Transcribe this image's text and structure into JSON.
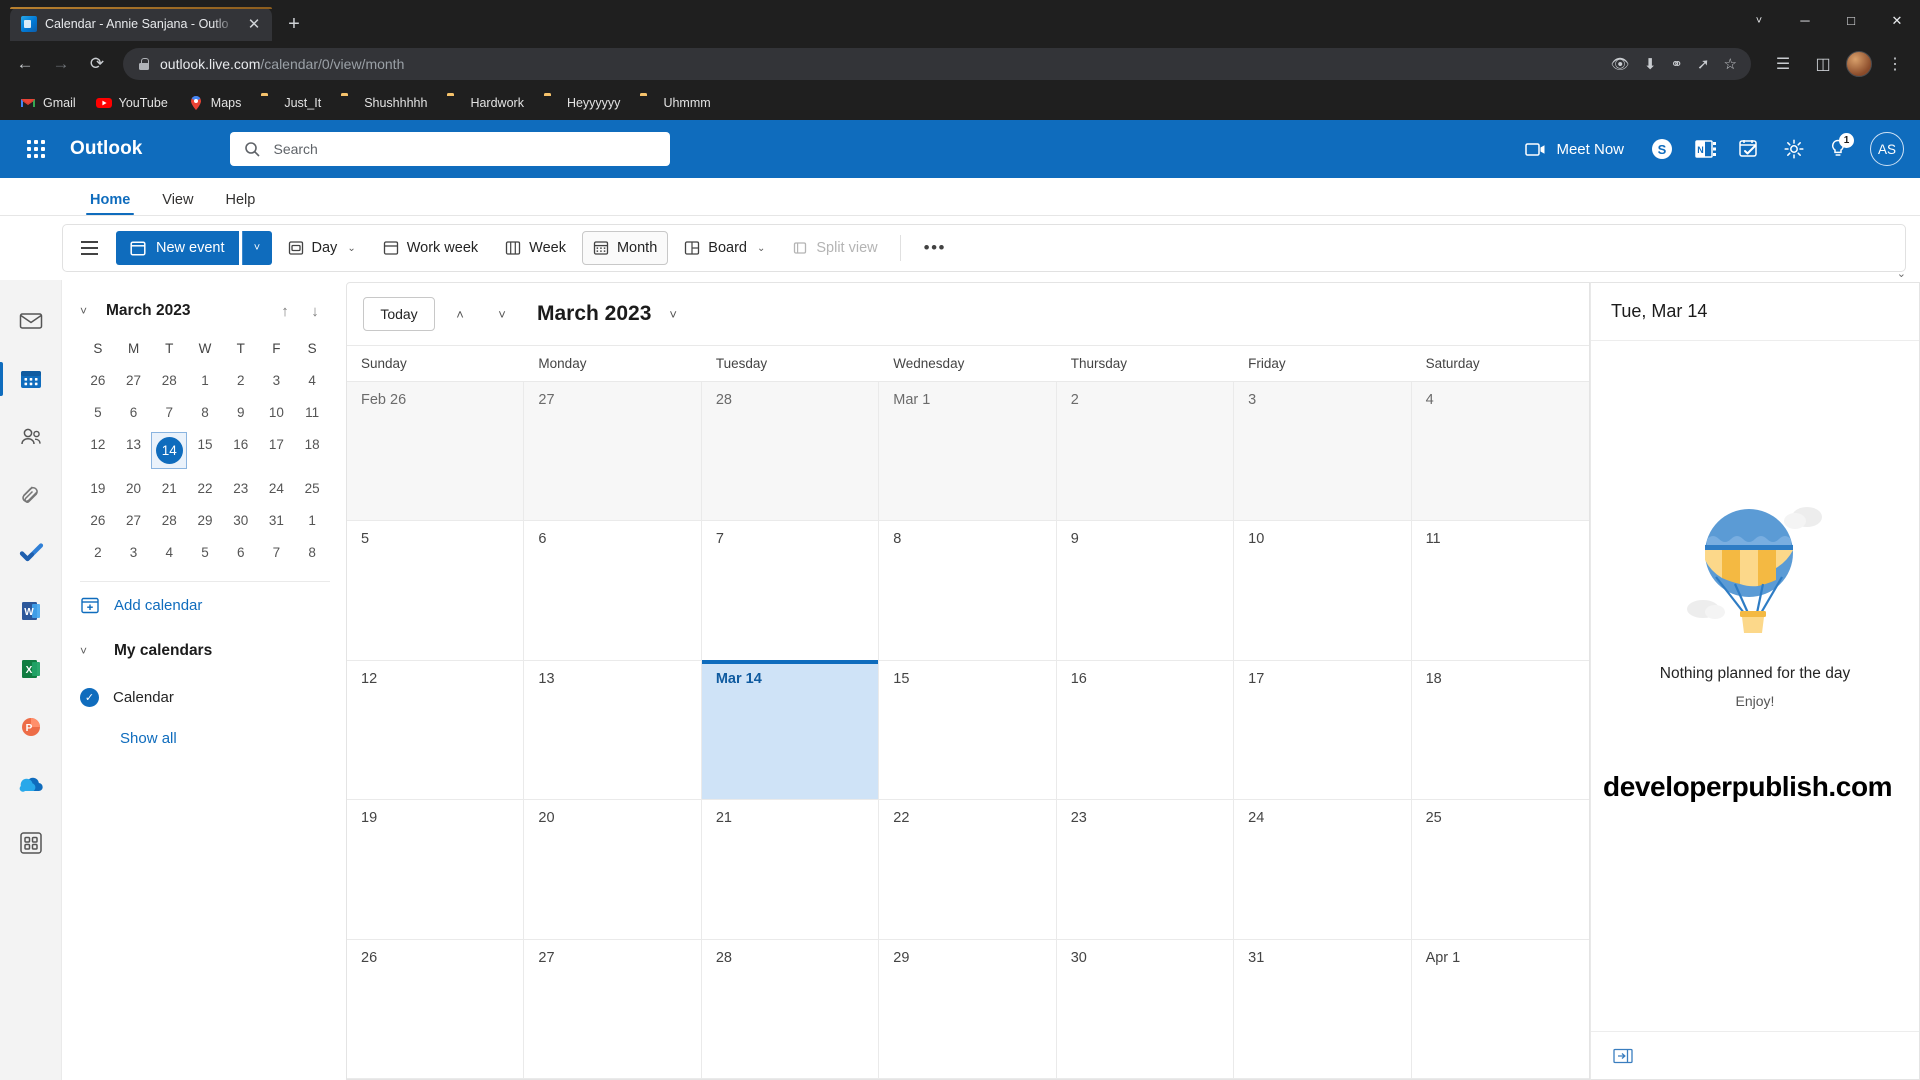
{
  "browser": {
    "tab": {
      "title": "Calendar - Annie Sanjana - Outlo",
      "favicon": "outlook-favicon",
      "close_label": "✕"
    },
    "new_tab_label": "+",
    "window_controls": {
      "more": "˅",
      "minimize": "─",
      "maximize": "□",
      "close": "✕"
    },
    "nav": {
      "back": "←",
      "forward": "→",
      "reload": "⟳"
    },
    "omnibox": {
      "url_domain": "outlook.live.com",
      "url_path": "/calendar/0/view/month"
    },
    "omnibox_icons": [
      "eye-icon",
      "download-icon",
      "eye-off-icon",
      "share-icon",
      "star-icon"
    ],
    "nav_right_icons": [
      "reading-list-icon",
      "split-screen-icon",
      "profile-avatar",
      "more-menu-icon"
    ],
    "bookmarks": [
      {
        "label": "Gmail",
        "icon": "gmail-icon"
      },
      {
        "label": "YouTube",
        "icon": "youtube-icon"
      },
      {
        "label": "Maps",
        "icon": "maps-pin-icon"
      },
      {
        "label": "Just_It",
        "icon": "folder-icon"
      },
      {
        "label": "Shushhhhh",
        "icon": "folder-icon"
      },
      {
        "label": "Hardwork",
        "icon": "folder-icon"
      },
      {
        "label": "Heyyyyyy",
        "icon": "folder-icon"
      },
      {
        "label": "Uhmmm",
        "icon": "folder-icon"
      }
    ]
  },
  "outlook": {
    "brand": "Outlook",
    "search_placeholder": "Search",
    "meet_now": "Meet Now",
    "notification_badge": "1",
    "avatar_initials": "AS",
    "header_icons": [
      "waffle-icon",
      "meet-now-camera-icon",
      "skype-icon",
      "onenote-icon",
      "todo-icon",
      "settings-gear-icon",
      "help-bulb-icon"
    ],
    "ribbon_tabs": [
      {
        "label": "Home",
        "active": true
      },
      {
        "label": "View",
        "active": false
      },
      {
        "label": "Help",
        "active": false
      }
    ],
    "ribbon": {
      "new_event": "New event",
      "new_event_caret": "˅",
      "buttons": [
        {
          "label": "Day",
          "icon": "day-view-icon",
          "caret": true,
          "selected": false,
          "disabled": false
        },
        {
          "label": "Work week",
          "icon": "work-week-icon",
          "caret": false,
          "selected": false,
          "disabled": false
        },
        {
          "label": "Week",
          "icon": "week-view-icon",
          "caret": false,
          "selected": false,
          "disabled": false
        },
        {
          "label": "Month",
          "icon": "month-view-icon",
          "caret": false,
          "selected": true,
          "disabled": false
        },
        {
          "label": "Board",
          "icon": "board-view-icon",
          "caret": true,
          "selected": false,
          "disabled": false
        },
        {
          "label": "Split view",
          "icon": "split-view-icon",
          "caret": false,
          "selected": false,
          "disabled": true
        }
      ],
      "overflow": "•••"
    },
    "rail_items": [
      {
        "name": "mail",
        "active": false
      },
      {
        "name": "calendar",
        "active": true
      },
      {
        "name": "people",
        "active": false
      },
      {
        "name": "files",
        "active": false
      },
      {
        "name": "todo",
        "active": false
      },
      {
        "name": "word",
        "active": false
      },
      {
        "name": "excel",
        "active": false
      },
      {
        "name": "powerpoint",
        "active": false
      },
      {
        "name": "onedrive",
        "active": false
      },
      {
        "name": "all-apps",
        "active": false
      }
    ],
    "left_pane": {
      "mini_title": "March 2023",
      "collapse_caret": "˅",
      "nav_up": "↑",
      "nav_down": "↓",
      "dow": [
        "S",
        "M",
        "T",
        "W",
        "T",
        "F",
        "S"
      ],
      "weeks": [
        [
          {
            "d": "26",
            "dim": true
          },
          {
            "d": "27",
            "dim": true
          },
          {
            "d": "28",
            "dim": true
          },
          {
            "d": "1",
            "dim": false
          },
          {
            "d": "2",
            "dim": false
          },
          {
            "d": "3",
            "dim": false
          },
          {
            "d": "4",
            "dim": false
          }
        ],
        [
          {
            "d": "5",
            "dim": false
          },
          {
            "d": "6",
            "dim": false
          },
          {
            "d": "7",
            "dim": false
          },
          {
            "d": "8",
            "dim": false
          },
          {
            "d": "9",
            "dim": false
          },
          {
            "d": "10",
            "dim": false
          },
          {
            "d": "11",
            "dim": false
          }
        ],
        [
          {
            "d": "12",
            "dim": false
          },
          {
            "d": "13",
            "dim": false
          },
          {
            "d": "14",
            "dim": false,
            "today": true
          },
          {
            "d": "15",
            "dim": false
          },
          {
            "d": "16",
            "dim": false
          },
          {
            "d": "17",
            "dim": false
          },
          {
            "d": "18",
            "dim": false
          }
        ],
        [
          {
            "d": "19",
            "dim": false
          },
          {
            "d": "20",
            "dim": false
          },
          {
            "d": "21",
            "dim": false
          },
          {
            "d": "22",
            "dim": false
          },
          {
            "d": "23",
            "dim": false
          },
          {
            "d": "24",
            "dim": false
          },
          {
            "d": "25",
            "dim": false
          }
        ],
        [
          {
            "d": "26",
            "dim": false
          },
          {
            "d": "27",
            "dim": false
          },
          {
            "d": "28",
            "dim": false
          },
          {
            "d": "29",
            "dim": false
          },
          {
            "d": "30",
            "dim": false
          },
          {
            "d": "31",
            "dim": false
          },
          {
            "d": "1",
            "dim": true
          }
        ],
        [
          {
            "d": "2",
            "dim": true
          },
          {
            "d": "3",
            "dim": true
          },
          {
            "d": "4",
            "dim": true
          },
          {
            "d": "5",
            "dim": true
          },
          {
            "d": "6",
            "dim": true
          },
          {
            "d": "7",
            "dim": true
          },
          {
            "d": "8",
            "dim": true
          }
        ]
      ],
      "add_calendar": "Add calendar",
      "my_calendars": "My calendars",
      "calendar_item": "Calendar",
      "show_all": "Show all"
    },
    "calendar": {
      "today_button": "Today",
      "prev_arrow": "˄",
      "next_arrow": "˅",
      "title": "March 2023",
      "title_caret": "˅",
      "day_headers": [
        "Sunday",
        "Monday",
        "Tuesday",
        "Wednesday",
        "Thursday",
        "Friday",
        "Saturday"
      ],
      "weeks": [
        [
          {
            "label": "Feb 26",
            "other": true
          },
          {
            "label": "27",
            "other": true
          },
          {
            "label": "28",
            "other": true
          },
          {
            "label": "Mar 1",
            "other": true
          },
          {
            "label": "2",
            "other": true
          },
          {
            "label": "3",
            "other": true
          },
          {
            "label": "4",
            "other": true
          }
        ],
        [
          {
            "label": "5",
            "other": false
          },
          {
            "label": "6",
            "other": false
          },
          {
            "label": "7",
            "other": false
          },
          {
            "label": "8",
            "other": false
          },
          {
            "label": "9",
            "other": false
          },
          {
            "label": "10",
            "other": false
          },
          {
            "label": "11",
            "other": false
          }
        ],
        [
          {
            "label": "12",
            "other": false
          },
          {
            "label": "13",
            "other": false
          },
          {
            "label": "Mar 14",
            "other": false,
            "selected": true
          },
          {
            "label": "15",
            "other": false
          },
          {
            "label": "16",
            "other": false
          },
          {
            "label": "17",
            "other": false
          },
          {
            "label": "18",
            "other": false
          }
        ],
        [
          {
            "label": "19",
            "other": false
          },
          {
            "label": "20",
            "other": false
          },
          {
            "label": "21",
            "other": false
          },
          {
            "label": "22",
            "other": false
          },
          {
            "label": "23",
            "other": false
          },
          {
            "label": "24",
            "other": false
          },
          {
            "label": "25",
            "other": false
          }
        ],
        [
          {
            "label": "26",
            "other": false
          },
          {
            "label": "27",
            "other": false
          },
          {
            "label": "28",
            "other": false
          },
          {
            "label": "29",
            "other": false
          },
          {
            "label": "30",
            "other": false
          },
          {
            "label": "31",
            "other": false
          },
          {
            "label": "Apr 1",
            "other": false
          }
        ]
      ]
    },
    "agenda": {
      "date_header": "Tue, Mar 14",
      "empty_title": "Nothing planned for the day",
      "empty_subtitle": "Enjoy!",
      "watermark": "developerpublish.com",
      "footer_icon": "expand-panel-icon"
    }
  },
  "colors": {
    "outlook_blue": "#0f6cbd",
    "selected_day_bg": "#cfe3f7",
    "chrome_dark": "#1f1f1f",
    "rail_bg": "#f3f3f3"
  }
}
